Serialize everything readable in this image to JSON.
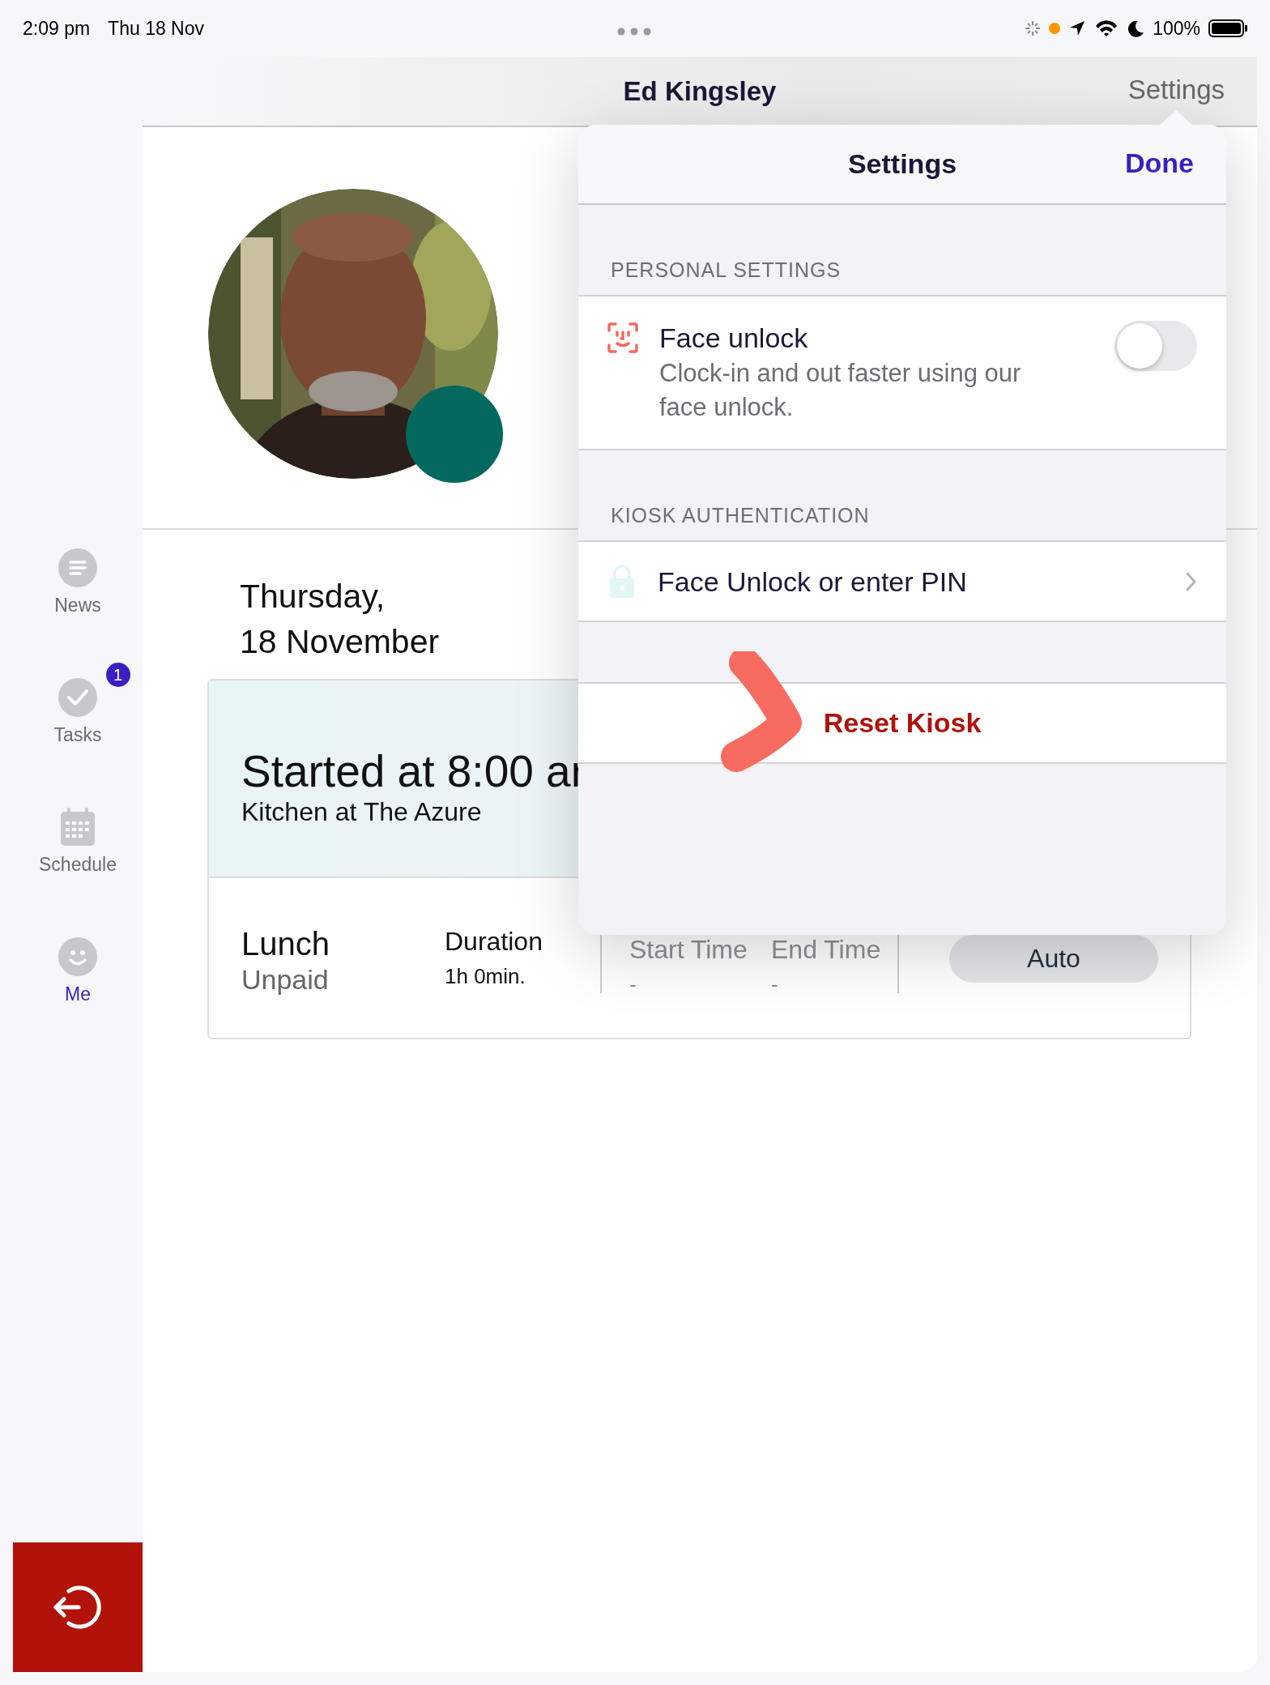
{
  "status_bar": {
    "time": "2:09 pm",
    "date": "Thu 18 Nov",
    "battery": "100%"
  },
  "header": {
    "title": "Ed Kingsley",
    "action": "Settings"
  },
  "sidebar": {
    "items": [
      {
        "kind": "news",
        "label": "News",
        "selected": false
      },
      {
        "kind": "tasks",
        "label": "Tasks",
        "selected": false,
        "badge": "1"
      },
      {
        "kind": "schedule",
        "label": "Schedule",
        "selected": false
      },
      {
        "kind": "me",
        "label": "Me",
        "selected": true
      }
    ]
  },
  "profile": {
    "avatar": {
      "kind": "picture"
    }
  },
  "date_lines": [
    "Thursday,",
    "18 November"
  ],
  "shift": {
    "title": "Started at 8:00 ar",
    "location": "Kitchen at The Azure"
  },
  "break": {
    "name": "Lunch",
    "type": "Unpaid",
    "duration_label": "Duration",
    "duration": "1h 0min.",
    "start_label": "Start Time",
    "start": "-",
    "end_label": "End Time",
    "end": "-",
    "button": "Auto"
  },
  "settings": {
    "title": "Settings",
    "done": "Done",
    "sections": [
      {
        "header": "PERSONAL SETTINGS",
        "rows": [
          {
            "kind": "toggle",
            "title": "Face unlock",
            "subtitle": "Clock-in and out faster using our face unlock.",
            "on": false
          }
        ]
      },
      {
        "header": "KIOSK AUTHENTICATION",
        "rows": [
          {
            "kind": "link",
            "title": "Face Unlock or enter PIN"
          }
        ]
      },
      {
        "rows": [
          {
            "kind": "destructive",
            "title": "Reset Kiosk"
          }
        ]
      }
    ]
  }
}
